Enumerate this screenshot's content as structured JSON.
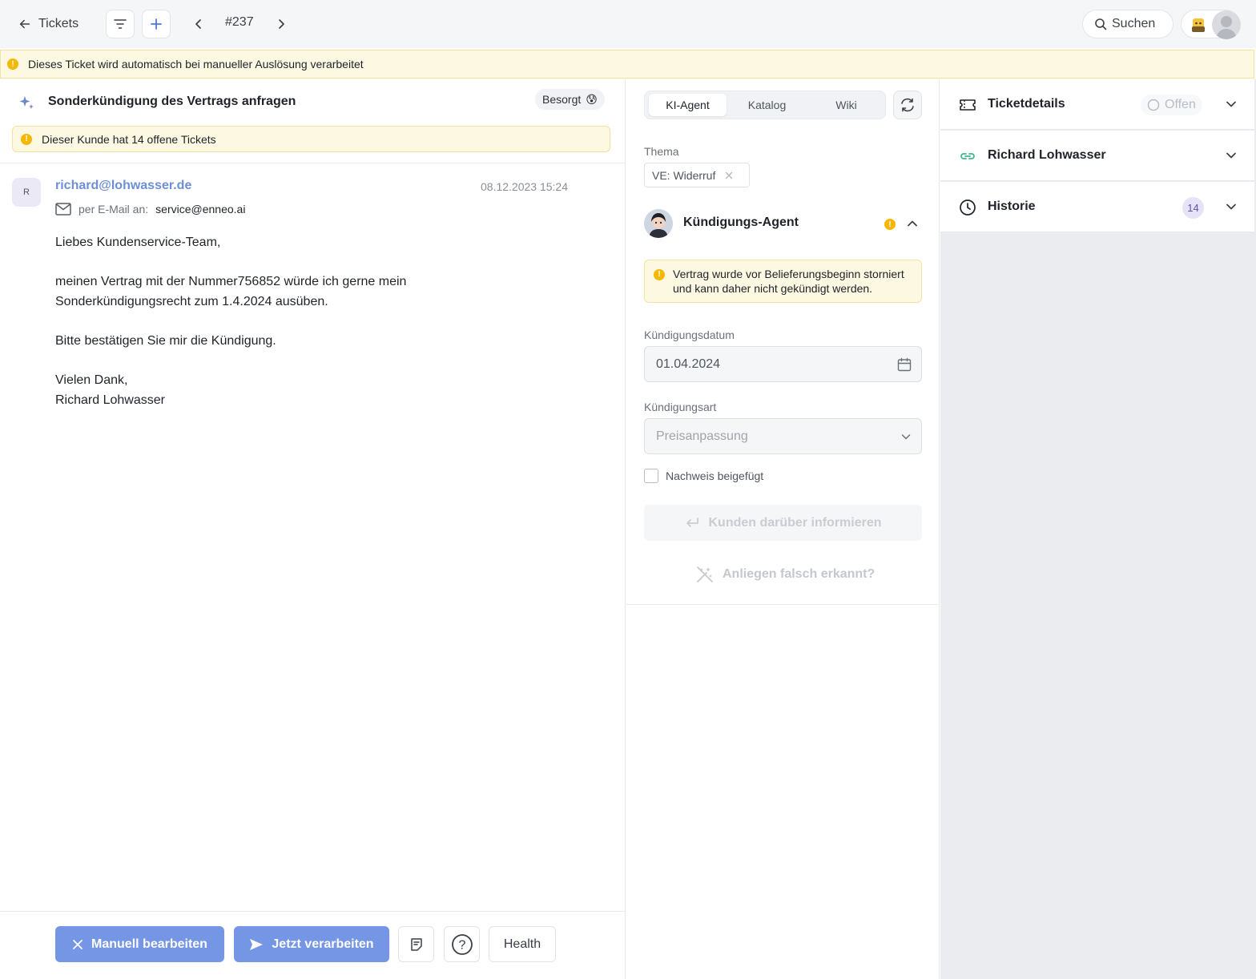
{
  "topbar": {
    "back_label": "Tickets",
    "ticket_number": "#237",
    "search_label": "Suchen"
  },
  "banner": {
    "text": "Dieses Ticket wird automatisch bei manueller Auslösung verarbeitet"
  },
  "ticket": {
    "subject": "Sonderkündigung des Vertrags anfragen",
    "mood_label": "Besorgt",
    "mood_emoji": "😰",
    "alert": "Dieser Kunde hat 14 offene Tickets"
  },
  "message": {
    "avatar_initial": "R",
    "sender": "richard@lohwasser.de",
    "date": "08.12.2023 15:24",
    "via_label": "per E-Mail an:",
    "via_address": "service@enneo.ai",
    "body": "Liebes Kundenservice-Team,\n\nmeinen Vertrag mit der Nummer756852 würde ich gerne mein\nSonderkündigungsrecht zum 1.4.2024 ausüben.\n\nBitte bestätigen Sie mir die Kündigung.\n\nVielen Dank,\nRichard Lohwasser"
  },
  "actions": {
    "manual_label": "Manuell bearbeiten",
    "process_label": "Jetzt verarbeiten",
    "health_label": "Health",
    "help_glyph": "?"
  },
  "agent_panel": {
    "tabs": [
      "KI-Agent",
      "Katalog",
      "Wiki"
    ],
    "topic_label": "Thema",
    "topic_value": "VE: Widerruf",
    "agent_name": "Kündigungs-Agent",
    "warning": "Vertrag wurde vor Belieferungsbeginn storniert und kann daher nicht gekündigt werden.",
    "date_label": "Kündigungsdatum",
    "date_value": "01.04.2024",
    "type_label": "Kündigungsart",
    "type_value": "Preisanpassung",
    "checkbox_label": "Nachweis beigefügt",
    "inform_label": "Kunden darüber informieren",
    "wrong_label": "Anliegen falsch erkannt?"
  },
  "sidebar": {
    "details_title": "Ticketdetails",
    "status": "Offen",
    "customer_title": "Richard Lohwasser",
    "history_title": "Historie",
    "history_count": "14"
  },
  "colors": {
    "primary": "#7596e4",
    "warning": "#f5b800",
    "link": "#6d8fd6"
  },
  "icons": [
    "arrow-left-icon",
    "filter-icon",
    "plus-icon",
    "chevron-left-icon",
    "chevron-right-icon",
    "search-icon",
    "sparkle-icon",
    "mail-icon",
    "close-icon",
    "send-icon",
    "note-icon",
    "help-icon",
    "refresh-icon",
    "calendar-icon",
    "chevron-down-icon",
    "chevron-up-icon",
    "enter-icon",
    "magic-off-icon",
    "ticket-icon",
    "link-icon",
    "clock-icon"
  ]
}
